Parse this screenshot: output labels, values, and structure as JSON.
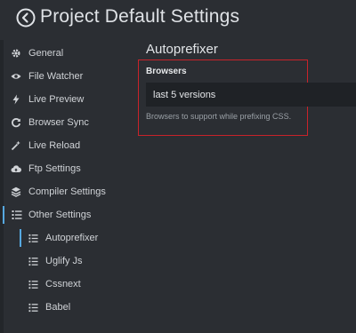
{
  "window": {
    "title": "Project Default Settings"
  },
  "sidebar": {
    "items": [
      {
        "label": "General",
        "icon": "gear-icon"
      },
      {
        "label": "File Watcher",
        "icon": "eye-icon"
      },
      {
        "label": "Live Preview",
        "icon": "bolt-icon"
      },
      {
        "label": "Browser Sync",
        "icon": "refresh-icon"
      },
      {
        "label": "Live Reload",
        "icon": "magic-wand-icon"
      },
      {
        "label": "Ftp Settings",
        "icon": "cloud-upload-icon"
      },
      {
        "label": "Compiler Settings",
        "icon": "layers-icon"
      },
      {
        "label": "Other Settings",
        "icon": "list-icon"
      }
    ],
    "subitems": [
      {
        "label": "Autoprefixer",
        "icon": "list-icon"
      },
      {
        "label": "Uglify Js",
        "icon": "list-icon"
      },
      {
        "label": "Cssnext",
        "icon": "list-icon"
      },
      {
        "label": "Babel",
        "icon": "list-icon"
      }
    ]
  },
  "main": {
    "section_title": "Autoprefixer",
    "field_label": "Browsers",
    "field_value": "last 5 versions",
    "field_help": "Browsers to support while prefixing CSS."
  },
  "colors": {
    "background": "#2b2e33",
    "input_bg": "#1f2226",
    "highlight_border": "#c8232a",
    "active_indicator": "#56a8e0"
  }
}
